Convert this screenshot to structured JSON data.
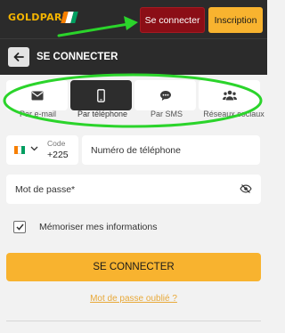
{
  "header": {
    "logo_text": "GoldPari",
    "connect_label": "Se connecter",
    "signup_label": "Inscription"
  },
  "titlebar": {
    "title": "SE CONNECTER"
  },
  "tabs": [
    {
      "label": "Par e-mail",
      "icon": "envelope-icon"
    },
    {
      "label": "Par téléphone",
      "icon": "smartphone-icon",
      "active": true
    },
    {
      "label": "Par SMS",
      "icon": "chat-bubble-icon"
    },
    {
      "label": "Réseaux sociaux",
      "icon": "users-icon"
    }
  ],
  "phone": {
    "code_label": "Code",
    "code_value": "+225",
    "placeholder": "Numéro de téléphone"
  },
  "password": {
    "placeholder": "Mot de passe*"
  },
  "remember": {
    "label": "Mémoriser mes informations",
    "checked": true
  },
  "submit_label": "SE CONNECTER",
  "forgot_label": "Mot de passe oublié ?",
  "colors": {
    "header_bg": "#2b2b2b",
    "connect_bg": "#8b0e16",
    "accent": "#f8b32f",
    "annotation_green": "#2bd42b"
  }
}
